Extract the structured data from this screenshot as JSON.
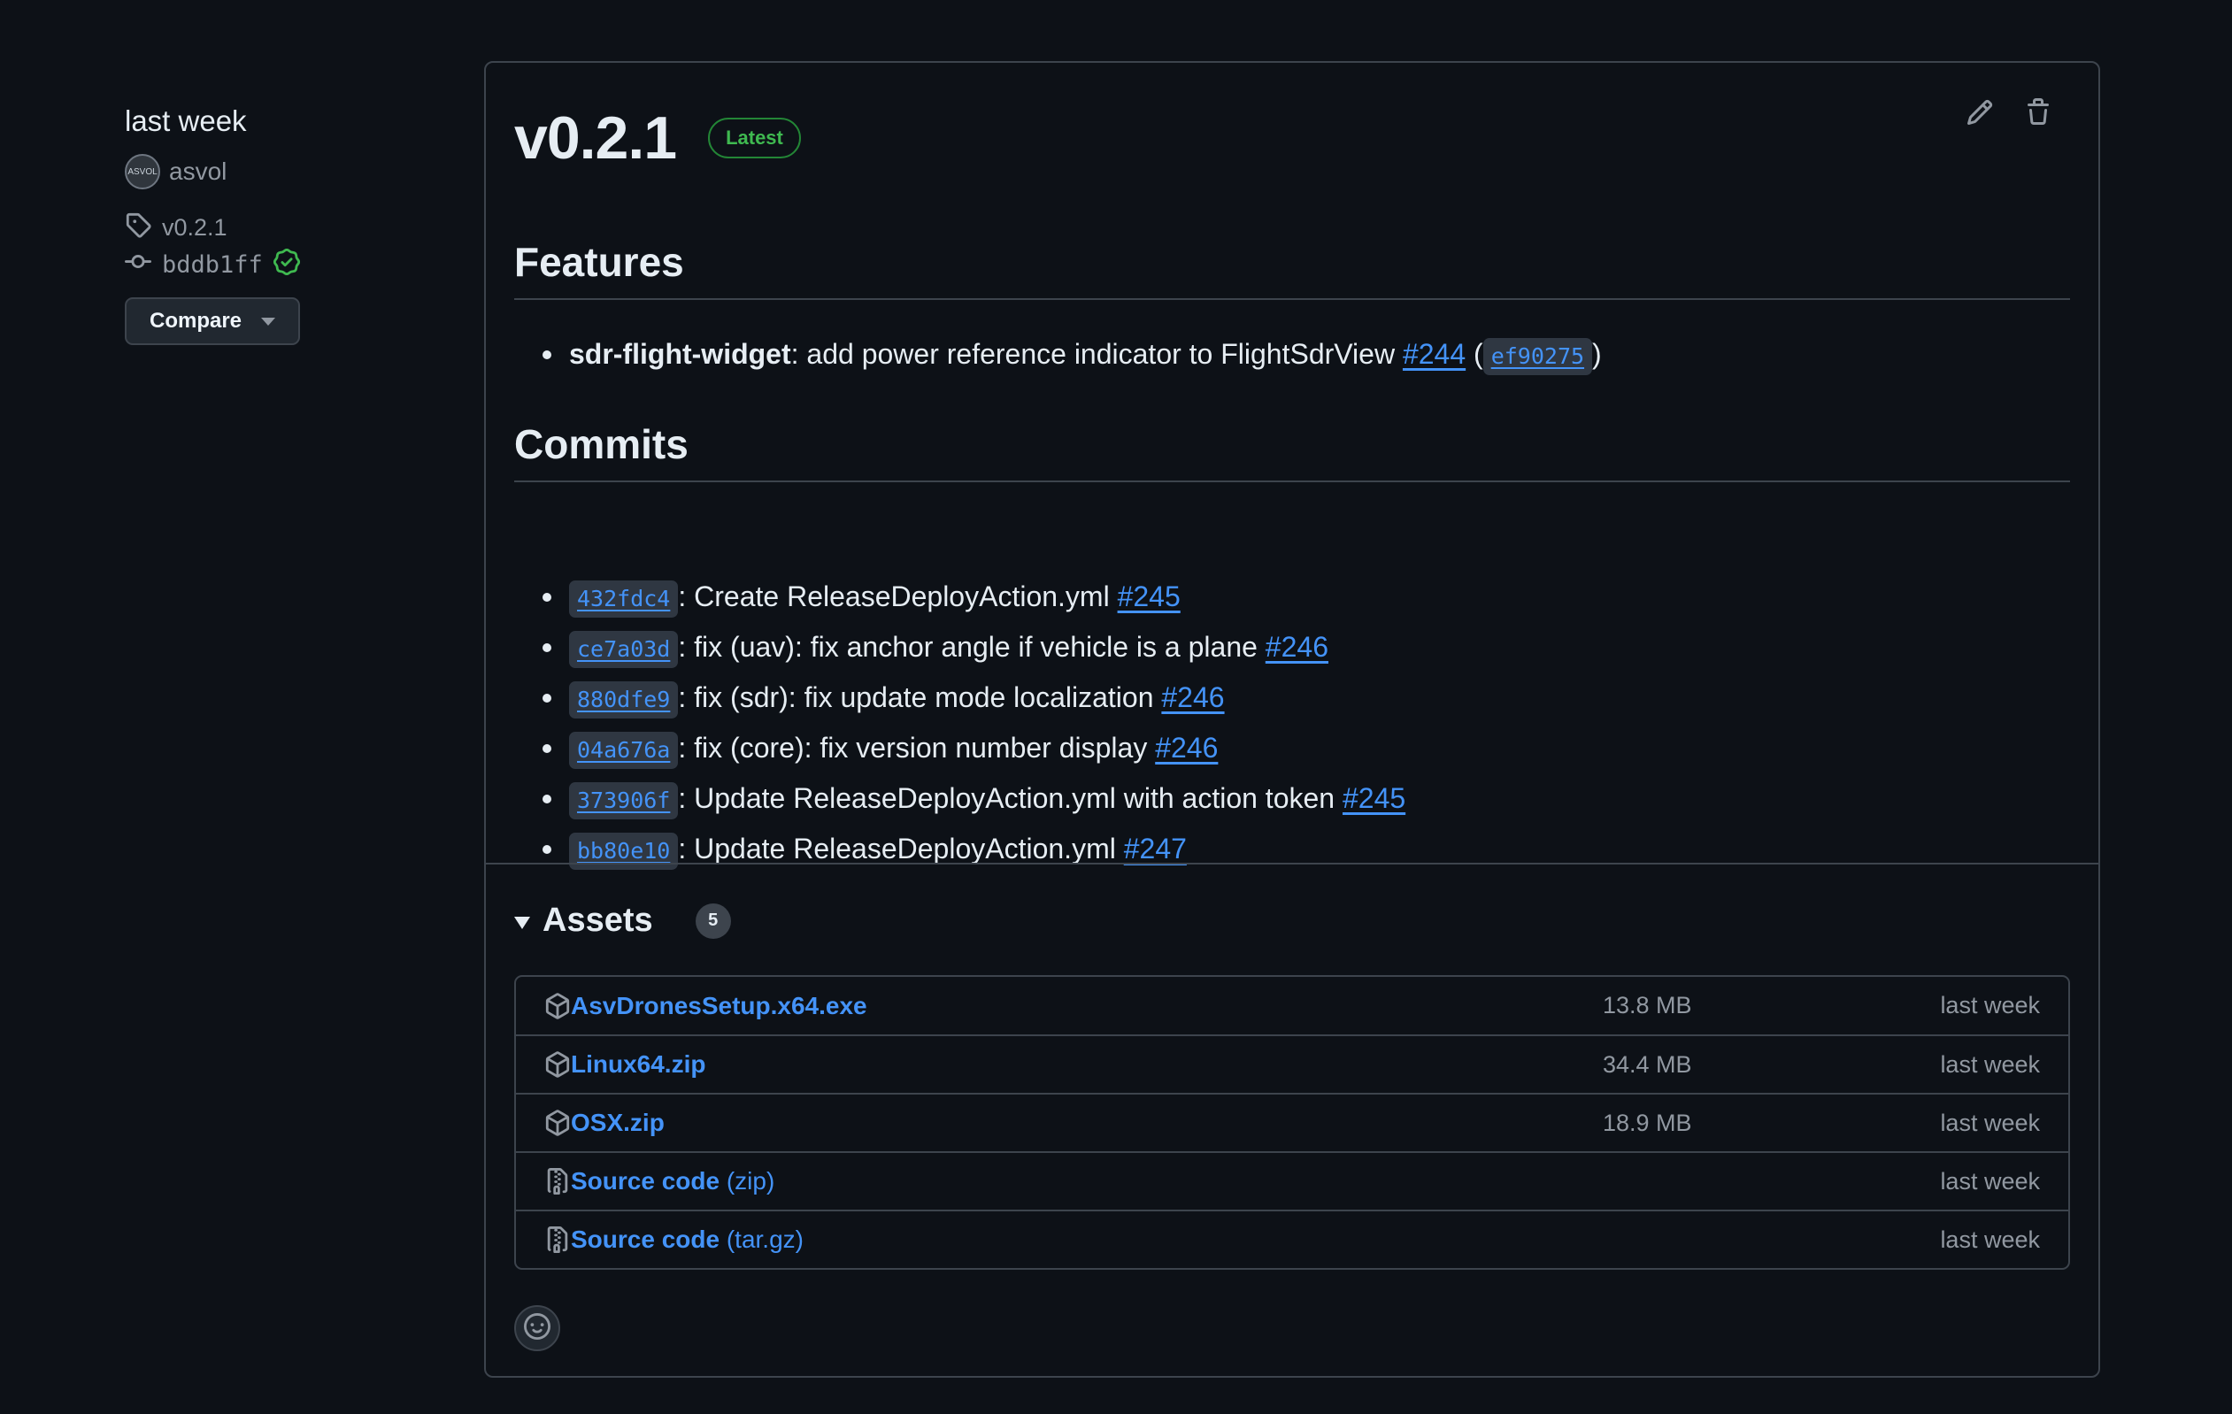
{
  "meta": {
    "date": "last week",
    "author": "asvol",
    "avatar_text": "ASVOL",
    "tag": "v0.2.1",
    "commit": "bddb1ff",
    "compare_label": "Compare"
  },
  "release": {
    "title": "v0.2.1",
    "badge": "Latest",
    "features_heading": "Features",
    "features": [
      {
        "scope": "sdr-flight-widget",
        "text": ": add power reference indicator to FlightSdrView ",
        "issue": "#244",
        "open_paren": "(",
        "sha": "ef90275",
        "close_paren": ")"
      }
    ],
    "commits_heading": "Commits",
    "commits": [
      {
        "sha": "432fdc4",
        "text": ": Create ReleaseDeployAction.yml ",
        "issue": "#245"
      },
      {
        "sha": "ce7a03d",
        "text": ": fix (uav): fix anchor angle if vehicle is a plane ",
        "issue": "#246"
      },
      {
        "sha": "880dfe9",
        "text": ": fix (sdr): fix update mode localization ",
        "issue": "#246"
      },
      {
        "sha": "04a676a",
        "text": ": fix (core): fix version number display ",
        "issue": "#246"
      },
      {
        "sha": "373906f",
        "text": ": Update ReleaseDeployAction.yml with action token ",
        "issue": "#245"
      },
      {
        "sha": "bb80e10",
        "text": ": Update ReleaseDeployAction.yml ",
        "issue": "#247"
      }
    ]
  },
  "assets": {
    "heading": "Assets",
    "count": "5",
    "items": [
      {
        "icon": "package-icon",
        "name": "AsvDronesSetup.x64.exe",
        "sub": "",
        "size": "13.8 MB",
        "date": "last week"
      },
      {
        "icon": "package-icon",
        "name": "Linux64.zip",
        "sub": "",
        "size": "34.4 MB",
        "date": "last week"
      },
      {
        "icon": "package-icon",
        "name": "OSX.zip",
        "sub": "",
        "size": "18.9 MB",
        "date": "last week"
      },
      {
        "icon": "file-zip-icon",
        "name": "Source code",
        "sub": "(zip)",
        "size": "",
        "date": "last week"
      },
      {
        "icon": "file-zip-icon",
        "name": "Source code",
        "sub": "(tar.gz)",
        "size": "",
        "date": "last week"
      }
    ]
  },
  "colors": {
    "background": "#0d1117",
    "link": "#4493f8",
    "latest": "#3fb950",
    "border": "#3d444d"
  }
}
